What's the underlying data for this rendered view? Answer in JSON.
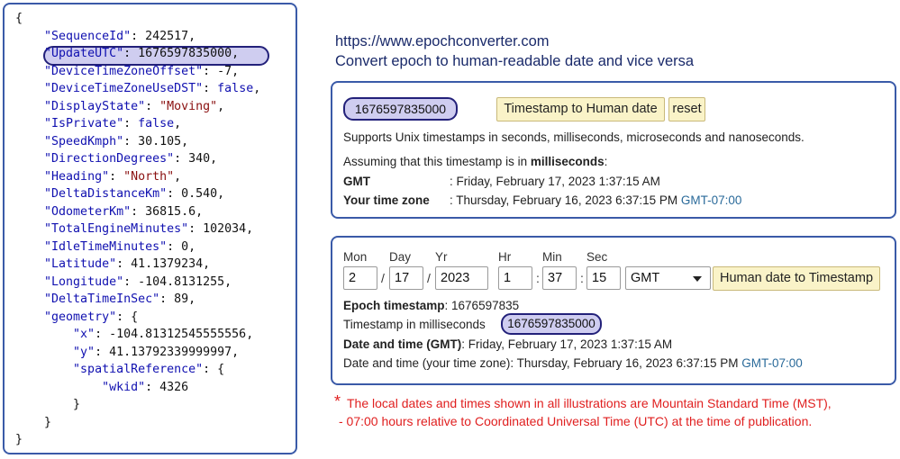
{
  "json_panel": {
    "lines": [
      "{",
      "    \"SequenceId\": 242517,",
      "    \"UpdateUTC\": 1676597835000,",
      "    \"DeviceTimeZoneOffset\": -7,",
      "    \"DeviceTimeZoneUseDST\": false,",
      "    \"DisplayState\": \"Moving\",",
      "    \"IsPrivate\": false,",
      "    \"SpeedKmph\": 30.105,",
      "    \"DirectionDegrees\": 340,",
      "    \"Heading\": \"North\",",
      "    \"DeltaDistanceKm\": 0.540,",
      "    \"OdometerKm\": 36815.6,",
      "    \"TotalEngineMinutes\": 102034,",
      "    \"IdleTimeMinutes\": 0,",
      "    \"Latitude\": 41.1379234,",
      "    \"Longitude\": -104.8131255,",
      "    \"DeltaTimeInSec\": 89,",
      "    \"geometry\": {",
      "        \"x\": -104.81312545555556,",
      "        \"y\": 41.13792339999997,",
      "        \"spatialReference\": {",
      "            \"wkid\": 4326",
      "        }",
      "    }",
      "}"
    ]
  },
  "header": {
    "url": "https://www.epochconverter.com",
    "tagline": "Convert epoch to human-readable date and vice versa"
  },
  "timestamp_box": {
    "input_value": "1676597835000",
    "convert_button": "Timestamp to Human date",
    "reset_button": "reset",
    "support_note": "Supports Unix timestamps in seconds, milliseconds, microseconds and nanoseconds.",
    "assuming_prefix": "Assuming that this timestamp is in ",
    "assuming_unit": "milliseconds",
    "assuming_suffix": ":",
    "gmt_label": "GMT",
    "gmt_value": ": Friday, February 17, 2023 1:37:15 AM",
    "local_label": "Your time zone",
    "local_value": ": Thursday, February 16, 2023 6:37:15 PM ",
    "local_tz": "GMT-07:00"
  },
  "human_date_box": {
    "labels": {
      "mon": "Mon",
      "day": "Day",
      "yr": "Yr",
      "hr": "Hr",
      "min": "Min",
      "sec": "Sec"
    },
    "values": {
      "mon": "2",
      "day": "17",
      "yr": "2023",
      "hr": "1",
      "min": "37",
      "sec": "15"
    },
    "separators": {
      "date": "/",
      "time": ":"
    },
    "timezone_select": "GMT",
    "convert_button": "Human date to Timestamp",
    "epoch_label": "Epoch timestamp",
    "epoch_value": ": 1676597835",
    "ms_label": "Timestamp in milliseconds",
    "ms_value": "1676597835000",
    "gmt_label": "Date and time (GMT)",
    "gmt_value": ": Friday, February 17, 2023 1:37:15 AM",
    "local_label": "Date and time (your time zone)",
    "local_value": ": Thursday, February 16, 2023 6:37:15 PM ",
    "local_tz": "GMT-07:00"
  },
  "footnote": {
    "star": "*",
    "line1": "The local dates and times shown in all illustrations are Mountain Standard Time (MST),",
    "line2": "- 07:00 hours relative to Coordinated Universal Time (UTC) at the time of publication."
  },
  "colors": {
    "panel_border": "#3a5aa8",
    "highlight_fill": "#cfcdf0",
    "highlight_border": "#23217a",
    "button_fill": "#faf3c8",
    "note_red": "#e02020",
    "link_blue": "#2a6a9a"
  }
}
